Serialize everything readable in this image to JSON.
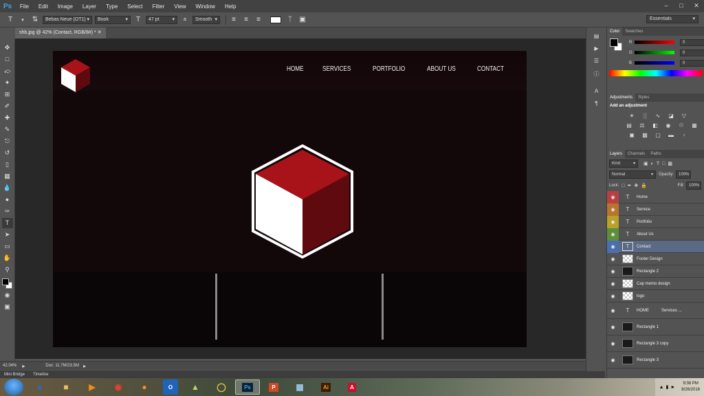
{
  "app": {
    "logo": "Ps"
  },
  "menu": [
    "File",
    "Edit",
    "Image",
    "Layer",
    "Type",
    "Select",
    "Filter",
    "View",
    "Window",
    "Help"
  ],
  "options": {
    "font_family": "Bebas Neue (OT1)",
    "font_style": "Book",
    "font_size": "47 pt",
    "antialias_icon": "a",
    "antialias_value": "Smooth",
    "text_color": "#ffffff",
    "workspace": "Essentials"
  },
  "document": {
    "tab_title": "shb.jpg @ 42% (Contact, RGB/8#) *"
  },
  "canvas": {
    "nav_links": [
      "HOME",
      "SERVICES",
      "PORTFOLIO",
      "ABOUT US",
      "CONTACT"
    ],
    "cube_colors": {
      "top": "#a8131a",
      "right": "#5e0a0e",
      "left": "#ffffff",
      "outline": "#ffffff"
    }
  },
  "status": {
    "zoom": "42.04%",
    "doc": "Doc: 11.7M/23.5M"
  },
  "mini_bridge": [
    "Mini Bridge",
    "Timeline"
  ],
  "color_panel": {
    "tabs": [
      "Color",
      "Swatches"
    ],
    "channels": [
      {
        "label": "R",
        "value": "0"
      },
      {
        "label": "G",
        "value": "0"
      },
      {
        "label": "B",
        "value": "0"
      }
    ]
  },
  "adjustments_panel": {
    "tabs": [
      "Adjustments",
      "Styles"
    ],
    "heading": "Add an adjustment"
  },
  "layers_panel": {
    "tabs": [
      "Layers",
      "Channels",
      "Paths"
    ],
    "kind": "Kind",
    "blend_mode": "Normal",
    "opacity_label": "Opacity:",
    "opacity": "100%",
    "lock_label": "Lock:",
    "fill_label": "Fill:",
    "fill": "100%",
    "layers": [
      {
        "name": "Home",
        "type": "text",
        "color": "#b94040"
      },
      {
        "name": "Service",
        "type": "text",
        "color": "#b8752f"
      },
      {
        "name": "Portfolio",
        "type": "text",
        "color": "#b9a12a"
      },
      {
        "name": "About Us",
        "type": "text",
        "color": "#5d8f3b"
      },
      {
        "name": "Contact",
        "type": "text",
        "color": "#4a6fb0",
        "selected": true
      },
      {
        "name": "Footer Design",
        "type": "image"
      },
      {
        "name": "Rectangle 2",
        "type": "shape"
      },
      {
        "name": "Cap memo design",
        "type": "image"
      },
      {
        "name": "logo",
        "type": "image"
      },
      {
        "name": "HOME",
        "type": "text",
        "extra": "Services ..."
      },
      {
        "name": "Rectangle 1",
        "type": "shape"
      },
      {
        "name": "Rectangle 3 copy",
        "type": "shape"
      },
      {
        "name": "Rectangle 3",
        "type": "shape"
      }
    ]
  },
  "taskbar": {
    "apps": [
      "IE",
      "Folder",
      "Media",
      "Chrome",
      "Firefox",
      "Outlook",
      "Notes",
      "Stickies",
      "Ps",
      "P",
      "Img",
      "Ai",
      "Acrobat"
    ],
    "time": "9:38 PM",
    "date": "8/26/2016"
  }
}
